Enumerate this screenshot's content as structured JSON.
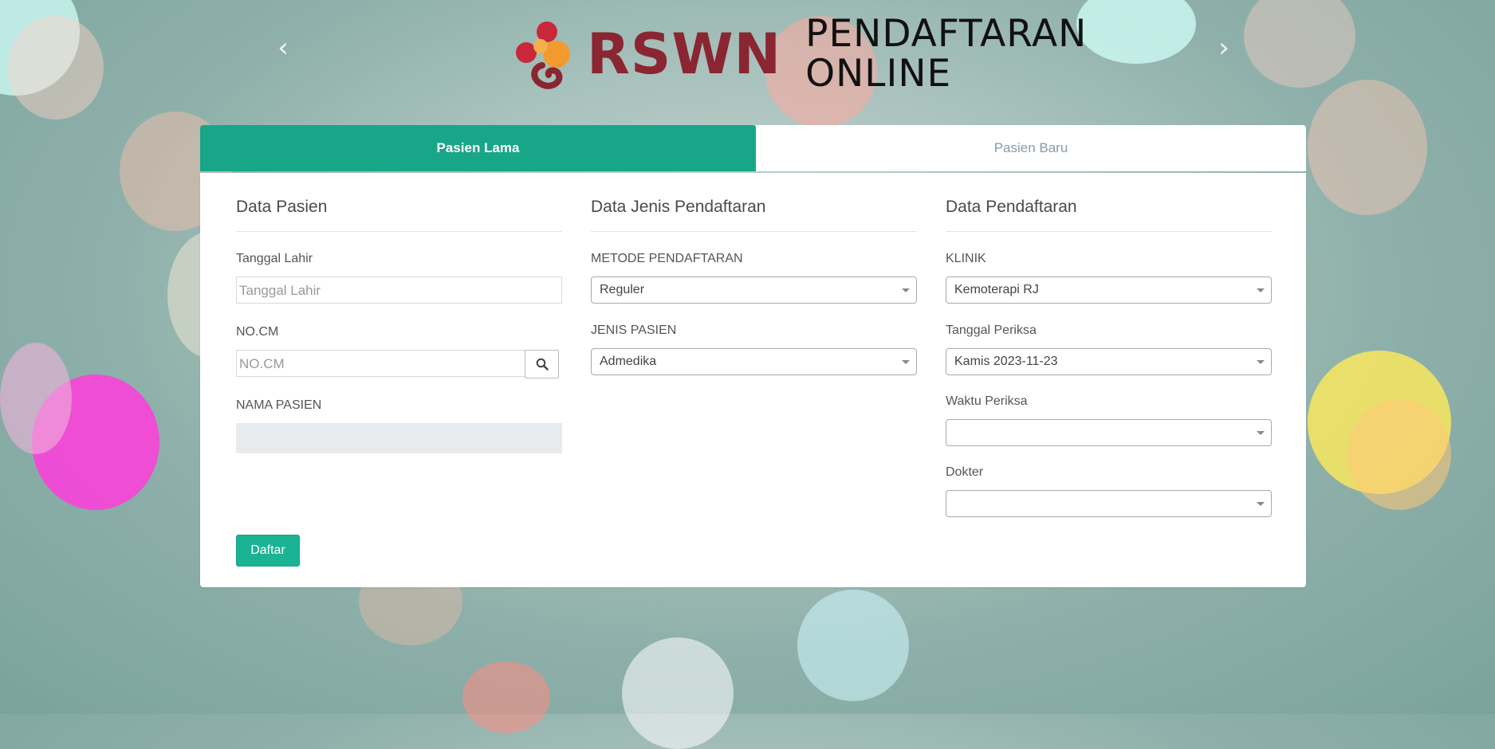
{
  "header": {
    "logo_text": "RSWN",
    "logo_subtitle_line1": "PENDAFTARAN",
    "logo_subtitle_line2": "ONLINE",
    "prev_arrow": "‹",
    "next_arrow": "›"
  },
  "tabs": [
    {
      "label": "Pasien Lama",
      "active": true
    },
    {
      "label": "Pasien Baru",
      "active": false
    }
  ],
  "data_pasien": {
    "title": "Data Pasien",
    "tanggal_lahir_label": "Tanggal Lahir",
    "tanggal_lahir_placeholder": "Tanggal Lahir",
    "nocm_label": "NO.CM",
    "nocm_placeholder": "NO.CM",
    "nama_label": "NAMA PASIEN",
    "nama_value": ""
  },
  "data_jenis": {
    "title": "Data Jenis Pendaftaran",
    "metode_label": "METODE PENDAFTARAN",
    "metode_value": "Reguler",
    "jenis_label": "JENIS PASIEN",
    "jenis_value": "Admedika"
  },
  "data_pendaftaran": {
    "title": "Data Pendaftaran",
    "klinik_label": "KLINIK",
    "klinik_value": "Kemoterapi RJ",
    "tanggal_label": "Tanggal Periksa",
    "tanggal_value": "Kamis 2023-11-23",
    "waktu_label": "Waktu Periksa",
    "waktu_value": "",
    "dokter_label": "Dokter",
    "dokter_value": ""
  },
  "actions": {
    "daftar_label": "Daftar"
  },
  "colors": {
    "accent": "#18a689",
    "logo_red": "#8a2631"
  },
  "icons": [
    "chevron-left-icon",
    "chevron-right-icon",
    "search-icon",
    "dropdown-caret-icon",
    "logo-mark-icon"
  ]
}
